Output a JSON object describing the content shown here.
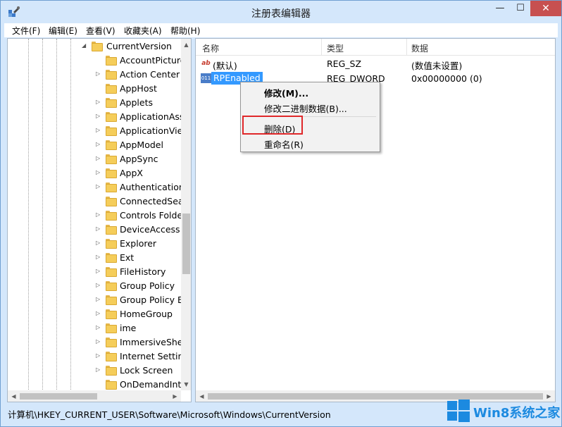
{
  "window": {
    "title": "注册表编辑器",
    "min_label": "—",
    "max_label": "☐",
    "close_label": "✕"
  },
  "menu": [
    {
      "label": "文件(F)"
    },
    {
      "label": "编辑(E)"
    },
    {
      "label": "查看(V)"
    },
    {
      "label": "收藏夹(A)"
    },
    {
      "label": "帮助(H)"
    }
  ],
  "tree": {
    "parent": {
      "label": "CurrentVersion",
      "expanded": true
    },
    "children": [
      {
        "label": "AccountPicture",
        "has_children": false
      },
      {
        "label": "Action Center",
        "has_children": true
      },
      {
        "label": "AppHost",
        "has_children": false
      },
      {
        "label": "Applets",
        "has_children": true
      },
      {
        "label": "ApplicationAss",
        "has_children": true
      },
      {
        "label": "ApplicationView",
        "has_children": true
      },
      {
        "label": "AppModel",
        "has_children": true
      },
      {
        "label": "AppSync",
        "has_children": true
      },
      {
        "label": "AppX",
        "has_children": true
      },
      {
        "label": "Authentication",
        "has_children": true
      },
      {
        "label": "ConnectedSear",
        "has_children": false
      },
      {
        "label": "Controls Folde",
        "has_children": true
      },
      {
        "label": "DeviceAccess",
        "has_children": true
      },
      {
        "label": "Explorer",
        "has_children": true
      },
      {
        "label": "Ext",
        "has_children": true
      },
      {
        "label": "FileHistory",
        "has_children": true
      },
      {
        "label": "Group Policy",
        "has_children": true
      },
      {
        "label": "Group Policy E",
        "has_children": true
      },
      {
        "label": "HomeGroup",
        "has_children": true
      },
      {
        "label": "ime",
        "has_children": true
      },
      {
        "label": "ImmersiveShel",
        "has_children": true
      },
      {
        "label": "Internet Setting",
        "has_children": true
      },
      {
        "label": "Lock Screen",
        "has_children": true
      },
      {
        "label": "OnDemandInte",
        "has_children": false
      }
    ]
  },
  "list": {
    "columns": [
      "名称",
      "类型",
      "数据"
    ],
    "rows": [
      {
        "icon": "ab",
        "name": "(默认)",
        "type": "REG_SZ",
        "data": "(数值未设置)",
        "selected": false
      },
      {
        "icon": "011",
        "name": "RPEnabled",
        "type": "REG_DWORD",
        "data": "0x00000000 (0)",
        "selected": true
      }
    ]
  },
  "context_menu": {
    "items": [
      {
        "label": "修改(M)...",
        "bold": true
      },
      {
        "label": "修改二进制数据(B)..."
      },
      {
        "label": "删除(D)",
        "highlighted": true
      },
      {
        "label": "重命名(R)"
      }
    ]
  },
  "status": {
    "path": "计算机\\HKEY_CURRENT_USER\\Software\\Microsoft\\Windows\\CurrentVersion"
  },
  "watermark": {
    "text": "Win8系统之家"
  },
  "colors": {
    "selection": "#3399ff",
    "highlight_box": "#e0282a",
    "brand": "#1c8ae0",
    "close_button": "#c75050"
  }
}
